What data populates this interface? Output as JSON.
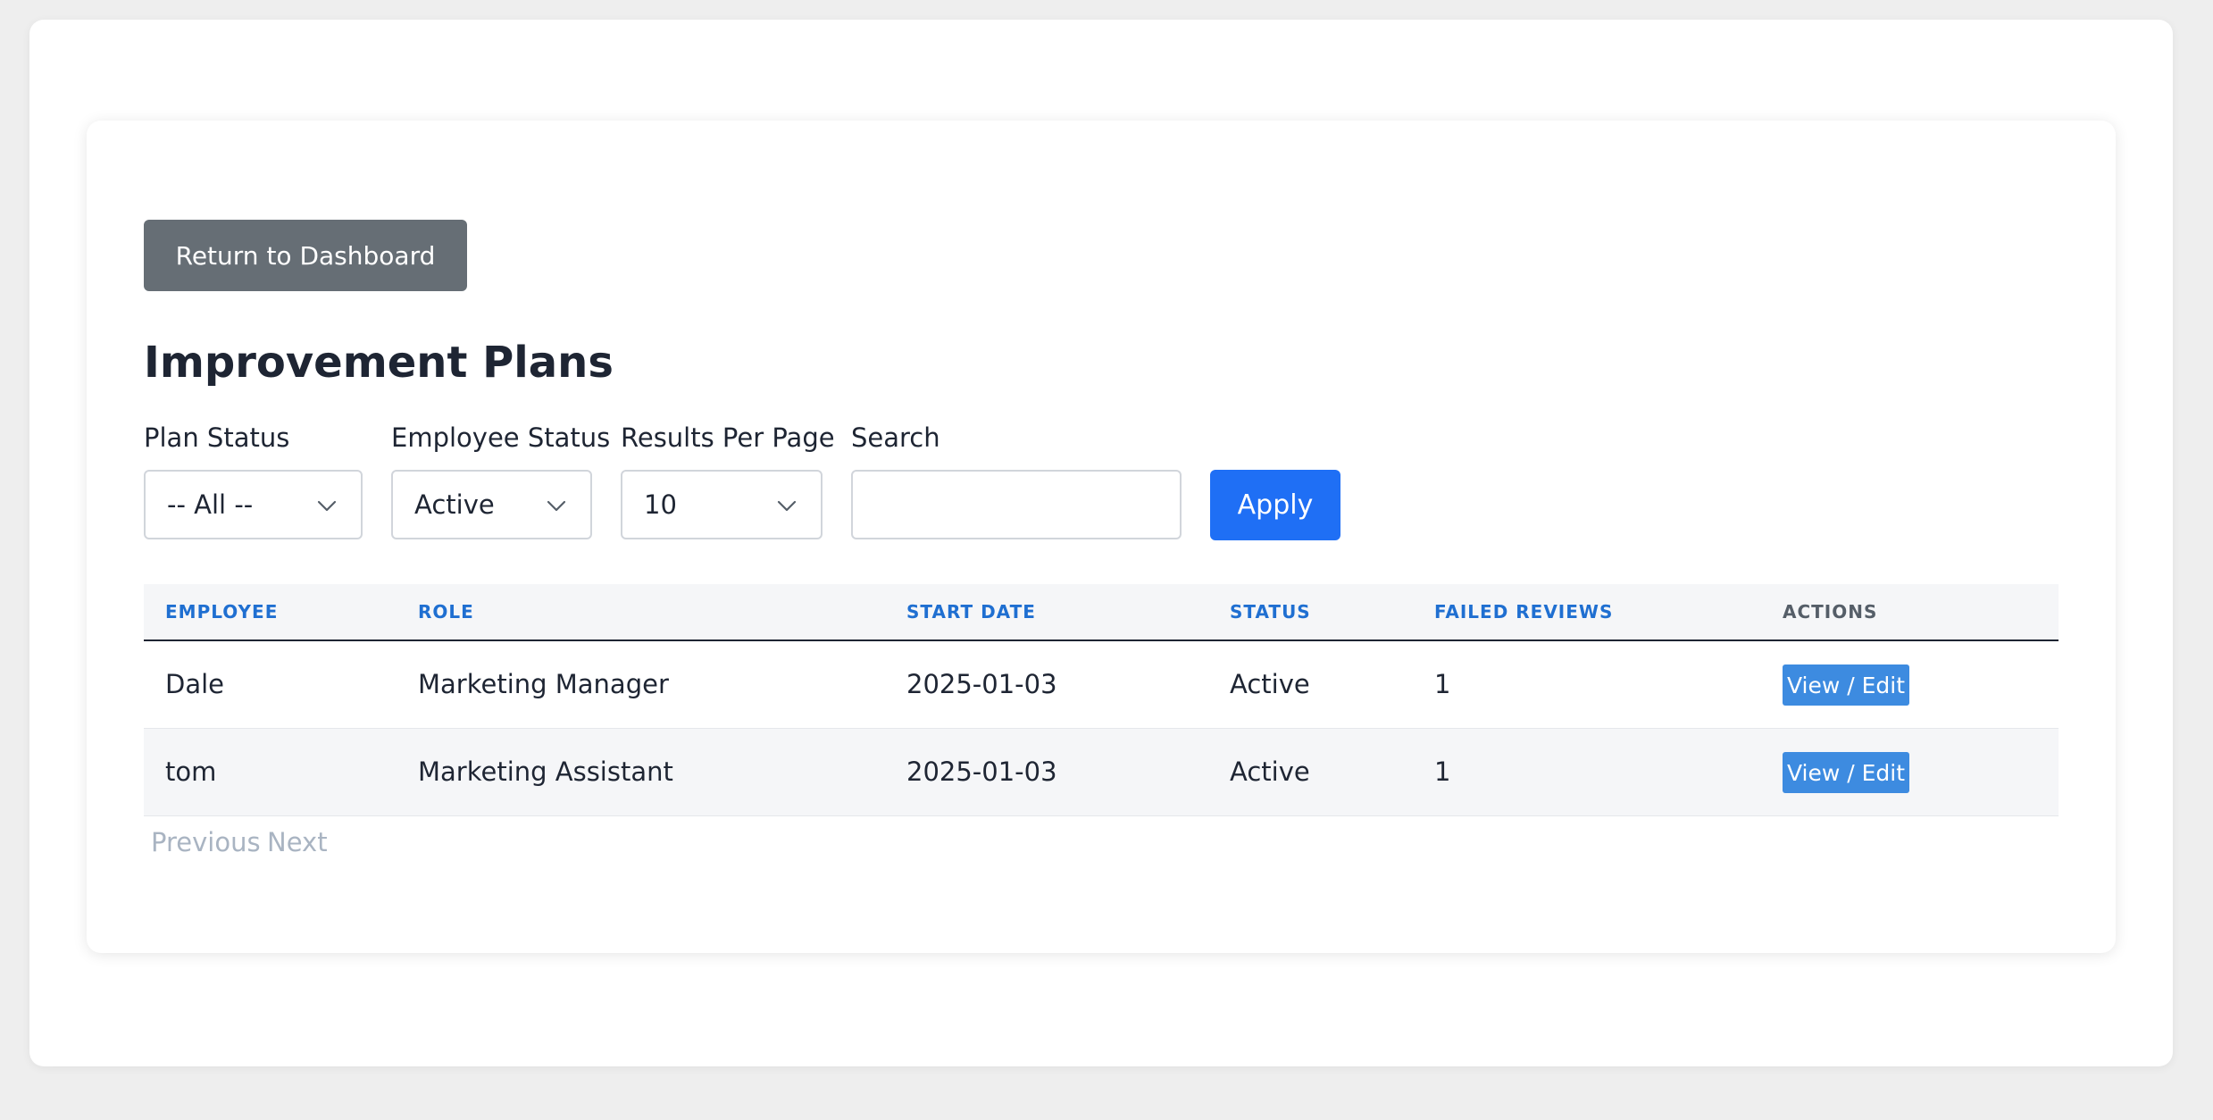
{
  "header": {
    "return_label": "Return to Dashboard",
    "title": "Improvement Plans"
  },
  "filters": {
    "plan_status": {
      "label": "Plan Status",
      "value": "-- All --"
    },
    "employee_status": {
      "label": "Employee Status",
      "value": "Active"
    },
    "results_per_page": {
      "label": "Results Per Page",
      "value": "10"
    },
    "search": {
      "label": "Search",
      "value": "",
      "placeholder": ""
    },
    "apply_label": "Apply"
  },
  "table": {
    "columns": [
      "EMPLOYEE",
      "ROLE",
      "START DATE",
      "STATUS",
      "FAILED REVIEWS",
      "ACTIONS"
    ],
    "rows": [
      {
        "employee": "Dale",
        "role": "Marketing Manager",
        "start_date": "2025-01-03",
        "status": "Active",
        "failed_reviews": "1",
        "action": "View / Edit"
      },
      {
        "employee": "tom",
        "role": "Marketing Assistant",
        "start_date": "2025-01-03",
        "status": "Active",
        "failed_reviews": "1",
        "action": "View / Edit"
      }
    ]
  },
  "pagination": {
    "previous": "Previous",
    "next": "Next"
  },
  "colors": {
    "primary": "#1f6ff5",
    "secondary": "#666e75",
    "header_link": "#1f6fd1",
    "action": "#3d8be0",
    "disabled": "#a9b4c2"
  },
  "icons": {
    "select_arrow": "chevron-down-icon"
  }
}
